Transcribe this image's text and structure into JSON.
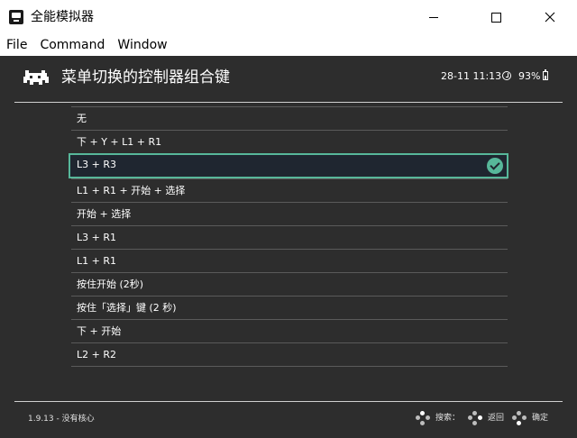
{
  "window": {
    "title": "全能模拟器",
    "menu": [
      "File",
      "Command",
      "Window"
    ]
  },
  "header": {
    "title": "菜单切换的控制器组合键",
    "datetime": "28-11 11:13",
    "battery": "93%"
  },
  "options": [
    {
      "label": "无",
      "selected": false
    },
    {
      "label": "下 + Y + L1 + R1",
      "selected": false
    },
    {
      "label": "L3 + R3",
      "selected": true
    },
    {
      "label": "L1 + R1 + 开始 + 选择",
      "selected": false
    },
    {
      "label": "开始 + 选择",
      "selected": false
    },
    {
      "label": "L3 + R1",
      "selected": false
    },
    {
      "label": "L1 + R1",
      "selected": false
    },
    {
      "label": "按住开始 (2秒)",
      "selected": false
    },
    {
      "label": "按住「选择」键 (2 秒)",
      "selected": false
    },
    {
      "label": "下 + 开始",
      "selected": false
    },
    {
      "label": "L2 + R2",
      "selected": false
    }
  ],
  "footer": {
    "version": "1.9.13 - 没有核心",
    "hints": [
      "搜索：",
      "返回",
      "确定"
    ]
  },
  "colors": {
    "accent": "#57b79a",
    "background": "#2d2d2d",
    "selected_bg": "#1f2630"
  },
  "icons": {
    "app": "retroarch-app-icon",
    "logo": "space-invader-icon",
    "clock": "clock-icon",
    "battery": "battery-icon",
    "check": "check-circle-icon",
    "buttons": "gamepad-face-buttons-icon"
  }
}
